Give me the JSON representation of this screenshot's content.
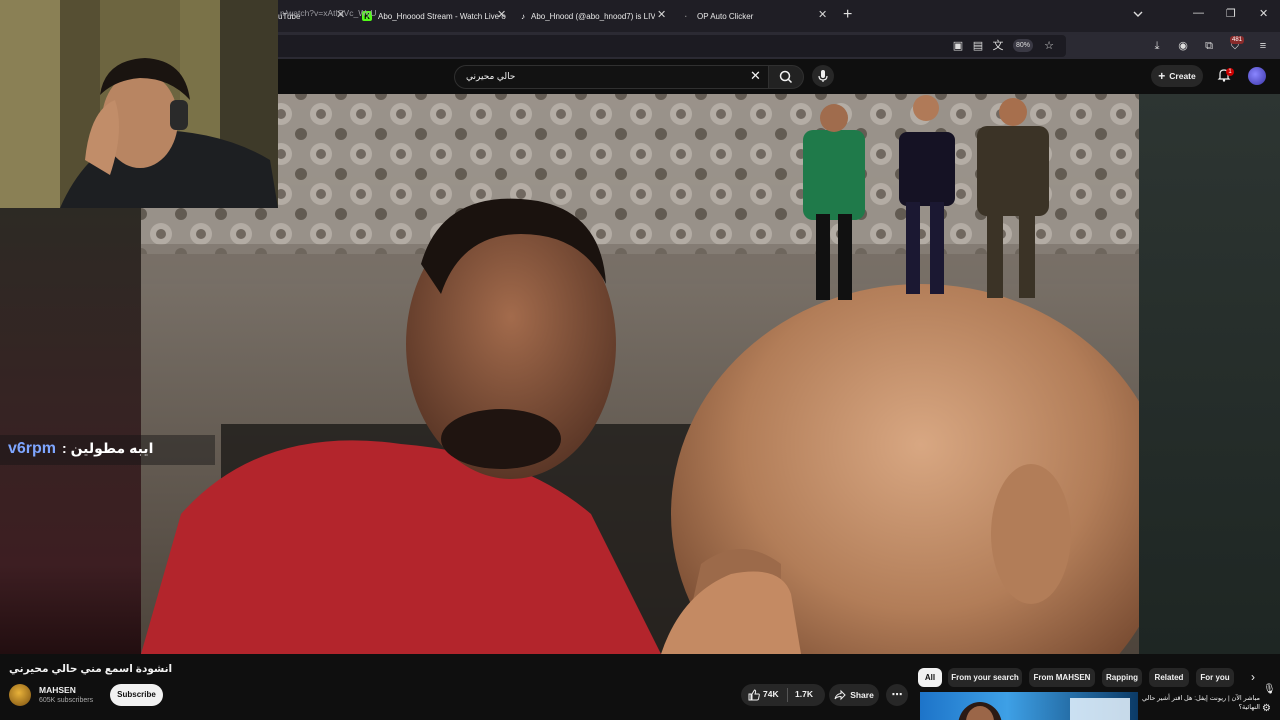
{
  "browser": {
    "tabs": [
      {
        "title": "uTube",
        "icon": "youtube-icon"
      },
      {
        "title": "Abo_Hnoood Stream - Watch Live o",
        "icon": "kick-icon"
      },
      {
        "title": "Abo_Hnood (@abo_hnood7) is LIVE",
        "icon": "tiktok-icon"
      },
      {
        "title": "OP Auto Clicker",
        "icon": "page-icon"
      }
    ],
    "url": "n/watch?v=xAtISVc_WyU",
    "zoom": "80%",
    "extensions_badge": "481"
  },
  "youtube": {
    "search_query": "حالي محيرني",
    "create_label": "Create",
    "notifications_count": "1"
  },
  "overlay": {
    "username": "v6rpm",
    "separator": ":",
    "message": "ايبه مطولين"
  },
  "video": {
    "title": "انشودة اسمع مني حالي محيرني",
    "channel_name": "MAHSEN",
    "subscribers": "605K subscribers",
    "subscribe_label": "Subscribe",
    "likes": "74K",
    "dislikes": "1.7K",
    "share_label": "Share"
  },
  "chips": [
    "All",
    "From your search",
    "From MAHSEN",
    "Rapping",
    "Related",
    "For you"
  ],
  "recommended": {
    "title": "مباشر الآن | ريونت إيفل: هل اقتر أشير حالي النهائية؟"
  },
  "colors": {
    "accent_red": "#cc0000",
    "overlay_user": "#7ea6ff",
    "shirt_red": "#b3252c"
  }
}
